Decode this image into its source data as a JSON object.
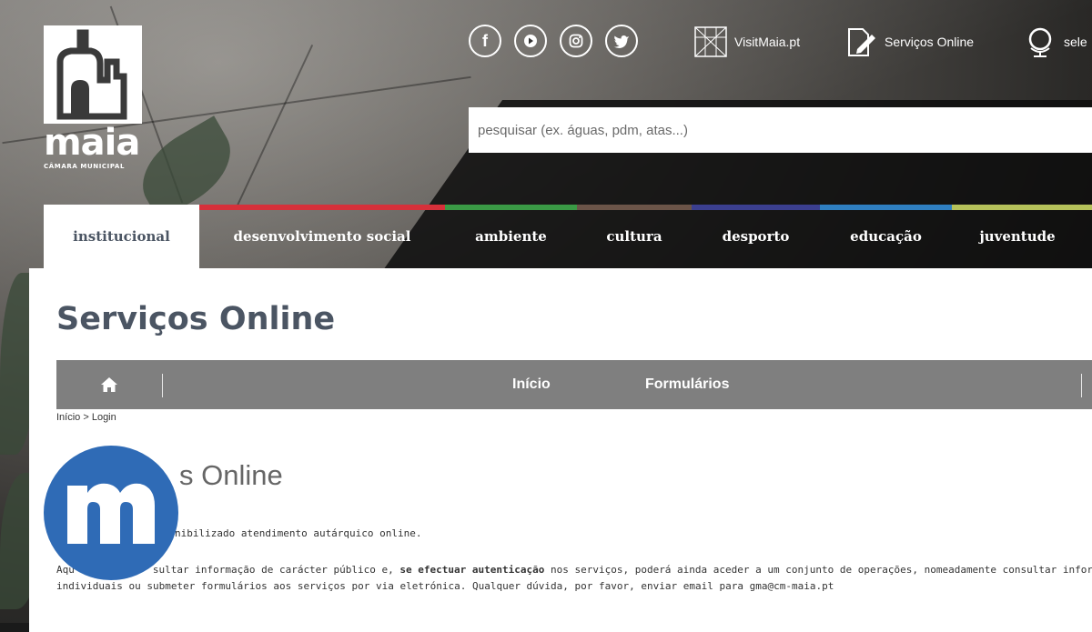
{
  "brand": {
    "name": "maia",
    "subtitle": "CÂMARA MUNICIPAL"
  },
  "header": {
    "social": [
      {
        "icon": "facebook-icon",
        "glyph": "f"
      },
      {
        "icon": "youtube-icon",
        "glyph": "▶"
      },
      {
        "icon": "instagram-icon",
        "glyph": "◎"
      },
      {
        "icon": "twitter-icon",
        "glyph": "🐦"
      }
    ],
    "visit_label": "VisitMaia.pt",
    "services_label": "Serviços Online",
    "language_label": "sele"
  },
  "search": {
    "placeholder": "pesquisar (ex. águas, pdm, atas...)"
  },
  "nav": {
    "items": [
      {
        "label": "institucional",
        "color": "#ffffff"
      },
      {
        "label": "desenvolvimento social",
        "color": "#d6303a"
      },
      {
        "label": "ambiente",
        "color": "#3a9a45"
      },
      {
        "label": "cultura",
        "color": "#6b5448"
      },
      {
        "label": "desporto",
        "color": "#3b3f8f"
      },
      {
        "label": "educação",
        "color": "#2f7fc1"
      },
      {
        "label": "juventude",
        "color": "#b5c15a"
      }
    ]
  },
  "page": {
    "title": "Serviços Online",
    "subnav": {
      "home_icon": "home-icon",
      "links": [
        "Início",
        "Formulários"
      ]
    },
    "breadcrumb": "Início > Login",
    "heading": "s Online",
    "para1": "nibilizado atendimento autárquico online.",
    "para2_start": "Aqu",
    "para2_a": "sultar informação de carácter público e, ",
    "para2_bold": "se efectuar autenticação",
    "para2_b": " nos serviços, poderá ainda aceder a um conjunto de operações, nomeadamente consultar informação relat",
    "para2_line2": "individuais ou submeter formulários aos serviços por via eletrónica. Qualquer dúvida, por favor, enviar email para gma@cm-maia.pt"
  },
  "badge": {
    "icon": "m-logo-icon",
    "color": "#2f6bb6"
  }
}
